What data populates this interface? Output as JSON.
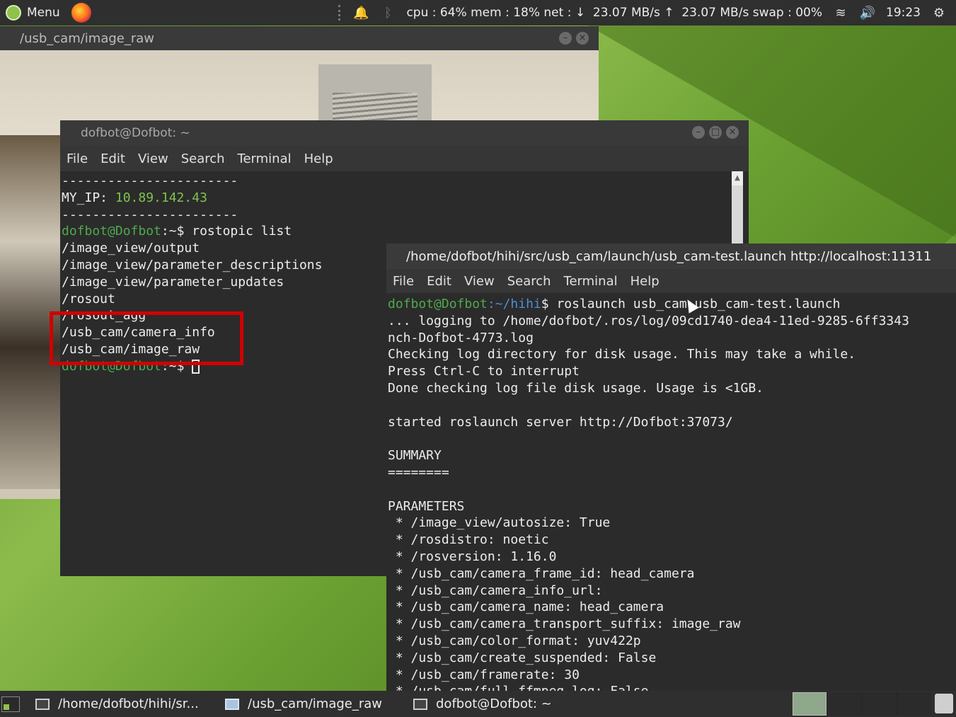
{
  "top_panel": {
    "menu_label": "Menu",
    "sysmon": "cpu : 64% mem : 18% net : ↓  23.07 MB/s ↑  23.07 MB/s swap : 00%",
    "clock": "19:23",
    "icons": [
      "mint-logo",
      "firefox-icon",
      "bell-icon",
      "bluetooth-icon",
      "wifi-icon",
      "volume-icon",
      "gear-icon"
    ]
  },
  "image_window": {
    "title": "/usb_cam/image_raw"
  },
  "terminal1": {
    "title": "dofbot@Dofbot: ~",
    "menu": [
      "File",
      "Edit",
      "View",
      "Search",
      "Terminal",
      "Help"
    ],
    "lines": {
      "sep1": "-----------------------",
      "ip_label": "MY_IP: ",
      "ip_value": "10.89.142.43",
      "sep2": "-----------------------",
      "prompt_user": "dofbot@Dofbot",
      "prompt_rest": ":~$ ",
      "cmd": "rostopic list",
      "t1": "/image_view/output",
      "t2": "/image_view/parameter_descriptions",
      "t3": "/image_view/parameter_updates",
      "t4": "/rosout",
      "t5": "/rosout_agg",
      "t6": "/usb_cam/camera_info",
      "t7": "/usb_cam/image_raw",
      "prompt2_user": "dofbot@Dofbot",
      "prompt2_rest": ":~$ "
    }
  },
  "terminal2": {
    "title": "/home/dofbot/hihi/src/usb_cam/launch/usb_cam-test.launch http://localhost:11311",
    "menu": [
      "File",
      "Edit",
      "View",
      "Search",
      "Terminal",
      "Help"
    ],
    "lines": {
      "prompt_user": "dofbot@Dofbot",
      "prompt_path": ":~/hihi",
      "prompt_end": "$ ",
      "cmd": "roslaunch usb_cam usb_cam-test.launch",
      "l1": "... logging to /home/dofbot/.ros/log/09cd1740-dea4-11ed-9285-6ff3343",
      "l2": "nch-Dofbot-4773.log",
      "l3": "Checking log directory for disk usage. This may take a while.",
      "l4": "Press Ctrl-C to interrupt",
      "l5": "Done checking log file disk usage. Usage is <1GB.",
      "l6": "",
      "l7": "started roslaunch server http://Dofbot:37073/",
      "l8": "",
      "l9": "SUMMARY",
      "l10": "========",
      "l11": "",
      "l12": "PARAMETERS",
      "l13": " * /image_view/autosize: True",
      "l14": " * /rosdistro: noetic",
      "l15": " * /rosversion: 1.16.0",
      "l16": " * /usb_cam/camera_frame_id: head_camera",
      "l17": " * /usb_cam/camera_info_url: ",
      "l18": " * /usb_cam/camera_name: head_camera",
      "l19": " * /usb_cam/camera_transport_suffix: image_raw",
      "l20": " * /usb_cam/color_format: yuv422p",
      "l21": " * /usb_cam/create_suspended: False",
      "l22": " * /usb_cam/framerate: 30",
      "l23": " * /usb_cam/full_ffmpeg_log: False"
    }
  },
  "taskbar": {
    "tasks": [
      {
        "label": "/home/dofbot/hihi/sr..."
      },
      {
        "label": "/usb_cam/image_raw"
      },
      {
        "label": "dofbot@Dofbot: ~"
      }
    ]
  }
}
